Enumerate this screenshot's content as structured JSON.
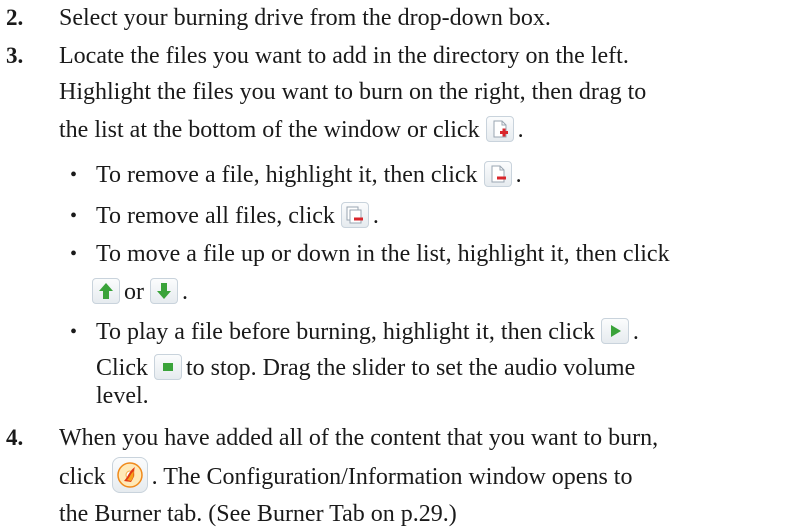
{
  "steps": [
    {
      "number": "2.",
      "lines": [
        "Select your burning drive from the drop-down box."
      ]
    },
    {
      "number": "3.",
      "line1": "Locate the files you want to add in the directory on the left.",
      "line2": "Highlight the files you want to burn on the right, then drag to",
      "line3_before": "the list at the bottom of the window or click",
      "line3_after": ".",
      "icon": "add-file-icon"
    },
    {
      "number": "4.",
      "line1": "When you have added all of the content that you want to burn,",
      "line2_before": "click",
      "line2_after": ". The Configuration/Information window opens to",
      "line3": "the Burner tab. (See Burner Tab on p.29.)",
      "icon": "burn-icon"
    }
  ],
  "bullets": [
    {
      "before": "To remove a file, highlight it, then click",
      "after": ".",
      "icon": "remove-file-icon"
    },
    {
      "before": "To remove all files, click",
      "after": ".",
      "icon": "remove-all-files-icon"
    },
    {
      "line1": "To move a file up or down in the list, highlight it, then click",
      "middle": "or",
      "after": ".",
      "icons": [
        "move-up-icon",
        "move-down-icon"
      ]
    },
    {
      "line1_before": "To play a file before burning, highlight it, then click",
      "line1_after": ".",
      "line2_before": "Click",
      "line2_after": "to stop. Drag the slider to set the audio volume",
      "line3": "level.",
      "icons": [
        "play-icon",
        "stop-icon"
      ]
    }
  ],
  "bullet_symbol": "•",
  "colors": {
    "text": "#1a1a1a",
    "icon_red": "#d9262c",
    "icon_green": "#3aa33a",
    "icon_flame": "#f08a1c"
  }
}
